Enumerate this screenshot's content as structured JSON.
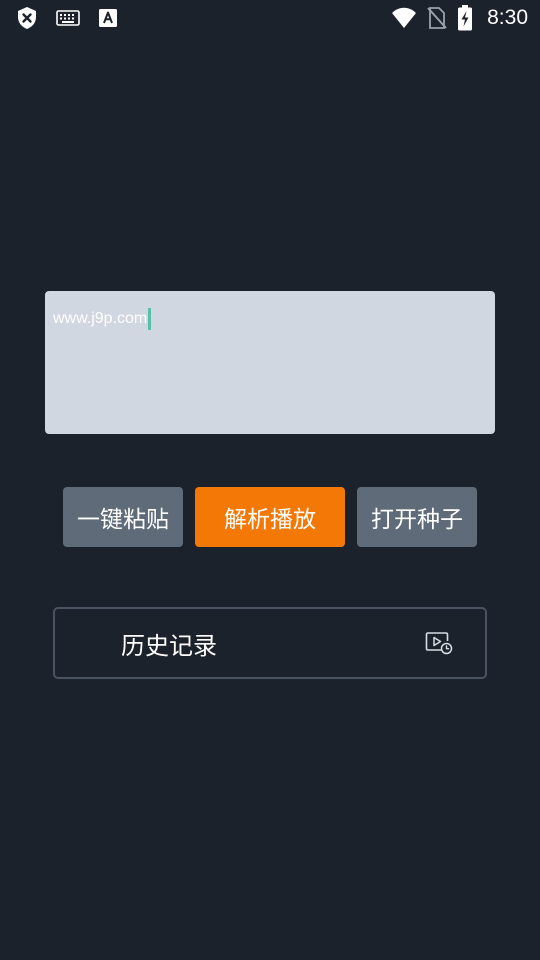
{
  "status_bar": {
    "time": "8:30",
    "left_icons": [
      "shield-x-icon",
      "keyboard-icon",
      "font-a-icon"
    ],
    "right_icons": [
      "wifi-icon",
      "no-sim-icon",
      "battery-charging-icon"
    ]
  },
  "url_input": {
    "value": "www.j9p.com"
  },
  "actions": {
    "paste_label": "一键粘贴",
    "play_label": "解析播放",
    "seed_label": "打开种子"
  },
  "history": {
    "label": "历史记录",
    "icon": "play-history-icon"
  },
  "colors": {
    "background": "#1c222b",
    "input_bg": "#d0d7e1",
    "primary": "#f47805",
    "secondary": "#5f6b78",
    "border": "#4a5361",
    "caret": "#56c0a8"
  }
}
